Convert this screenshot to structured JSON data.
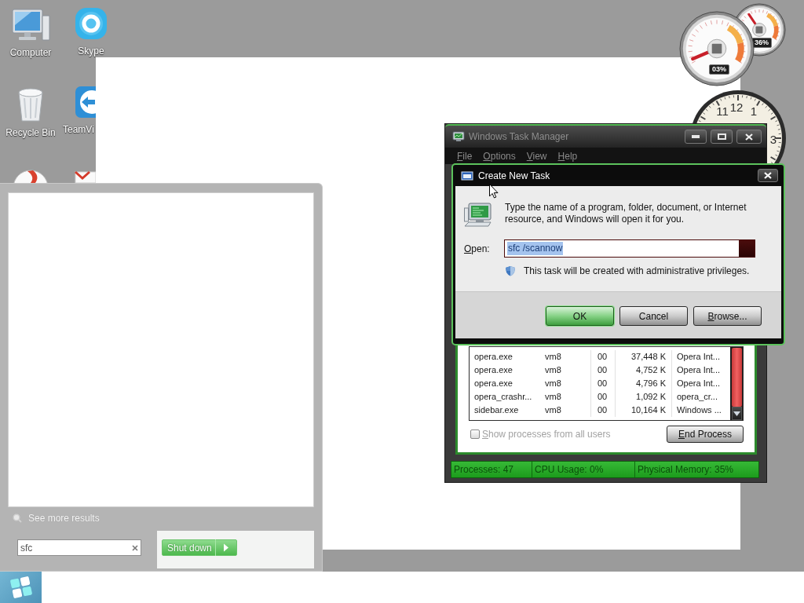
{
  "desktop": {
    "icons": [
      {
        "kind": "computer",
        "label": "Computer"
      },
      {
        "kind": "chat",
        "label": "Skype"
      },
      {
        "kind": "bin",
        "label": "Recycle Bin"
      },
      {
        "kind": "remote",
        "label": "TeamVi"
      },
      {
        "kind": "browser"
      },
      {
        "kind": "mail"
      }
    ]
  },
  "gadgets": {
    "cpu_meter": {
      "gauges": [
        {
          "reading": "03%"
        },
        {
          "reading": "36%"
        }
      ]
    },
    "clock": {
      "numerals": [
        "11",
        "12",
        "1",
        "3"
      ]
    }
  },
  "task_manager": {
    "title": "Windows Task Manager",
    "menu": [
      "File",
      "Options",
      "View",
      "Help"
    ],
    "processes": [
      {
        "column_1": "opera.exe",
        "column_2": "vm8",
        "column_3": "00",
        "column_4": "37,448 K",
        "column_5": "Opera Int..."
      },
      {
        "column_1": "opera.exe",
        "column_2": "vm8",
        "column_3": "00",
        "column_4": "4,752 K",
        "column_5": "Opera Int..."
      },
      {
        "column_1": "opera.exe",
        "column_2": "vm8",
        "column_3": "00",
        "column_4": "4,796 K",
        "column_5": "Opera Int..."
      },
      {
        "column_1": "opera_crashr...",
        "column_2": "vm8",
        "column_3": "00",
        "column_4": "1,092 K",
        "column_5": "opera_cr..."
      },
      {
        "column_1": "sidebar.exe",
        "column_2": "vm8",
        "column_3": "00",
        "column_4": "10,164 K",
        "column_5": "Windows ..."
      }
    ],
    "show_all_users": {
      "label": "Show processes from all users",
      "checked": false
    },
    "end_process_button": "End Process",
    "status_bar": [
      "Processes: 47",
      "CPU Usage: 0%",
      "Physical Memory: 35%"
    ]
  },
  "create_new_task": {
    "title": "Create New Task",
    "message": "Type the name of a program, folder, document, or Internet resource, and Windows will open it for you.",
    "open_label": "Open:",
    "open_value": "sfc /scannow",
    "value_selected": true,
    "admin_note": "This task will be created with administrative privileges.",
    "buttons": [
      {
        "label": "OK",
        "default": true,
        "mnemonic": false
      },
      {
        "label": "Cancel",
        "default": false,
        "mnemonic": false
      },
      {
        "label": "Browse...",
        "default": false,
        "mnemonic": true
      }
    ]
  },
  "start_menu": {
    "see_more_results": "See more results",
    "search": {
      "value": "sfc"
    },
    "shut_down_button": "Shut down"
  }
}
